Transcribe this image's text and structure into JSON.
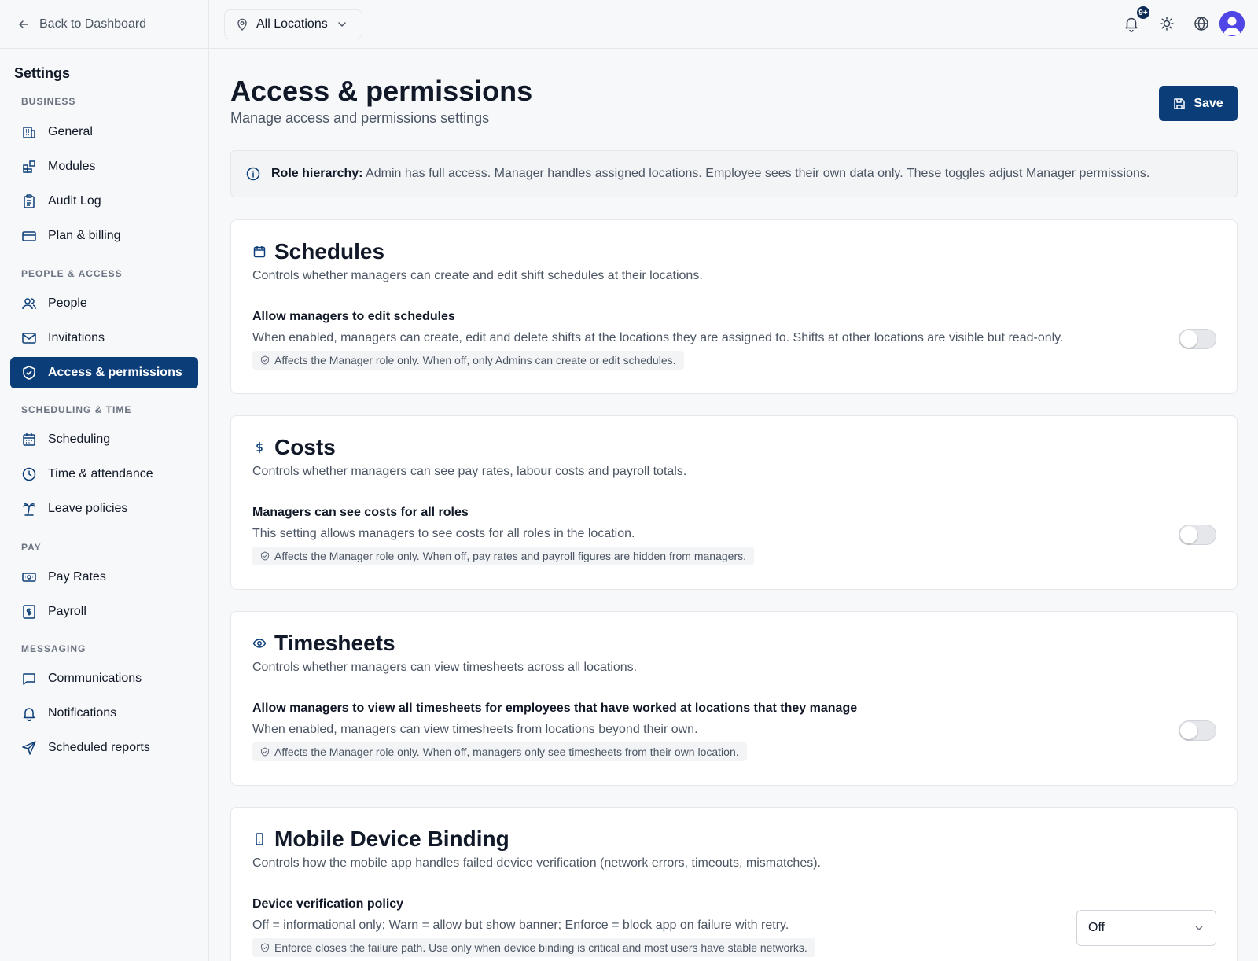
{
  "sidebar": {
    "back_label": "Back to Dashboard",
    "title": "Settings",
    "sections": {
      "business": "BUSINESS",
      "people": "PEOPLE & ACCESS",
      "scheduling": "SCHEDULING & TIME",
      "pay": "PAY",
      "messaging": "MESSAGING"
    },
    "items": {
      "general": "General",
      "modules": "Modules",
      "audit_log": "Audit Log",
      "plan_billing": "Plan & billing",
      "people": "People",
      "invitations": "Invitations",
      "access": "Access & permissions",
      "scheduling": "Scheduling",
      "time_attendance": "Time & attendance",
      "leave": "Leave policies",
      "pay_rates": "Pay Rates",
      "payroll": "Payroll",
      "communications": "Communications",
      "notifications": "Notifications",
      "scheduled_reports": "Scheduled reports"
    },
    "active_item": "access"
  },
  "topbar": {
    "location": "All Locations",
    "notification_badge": "9+"
  },
  "main": {
    "title": "Access & permissions",
    "subtitle": "Manage access and permissions settings",
    "save_label": "Save",
    "info": {
      "bold": "Role hierarchy:",
      "text": "Admin has full access. Manager handles assigned locations. Employee sees their own data only. These toggles adjust Manager permissions."
    },
    "cards": {
      "schedules": {
        "title": "Schedules",
        "desc": "Controls whether managers can create and edit shift schedules at their locations.",
        "row_title": "Allow managers to edit schedules",
        "row_desc": "When enabled, managers can create, edit and delete shifts at the locations they are assigned to. Shifts at other locations are visible but read-only.",
        "chip": "Affects the Manager role only. When off, only Admins can create or edit schedules.",
        "enabled": false
      },
      "costs": {
        "title": "Costs",
        "desc": "Controls whether managers can see pay rates, labour costs and payroll totals.",
        "row_title": "Managers can see costs for all roles",
        "row_desc": "This setting allows managers to see costs for all roles in the location.",
        "chip": "Affects the Manager role only. When off, pay rates and payroll figures are hidden from managers.",
        "enabled": false
      },
      "timesheets": {
        "title": "Timesheets",
        "desc": "Controls whether managers can view timesheets across all locations.",
        "row_title": "Allow managers to view all timesheets for employees that have worked at locations that they manage",
        "row_desc": "When enabled, managers can view timesheets from locations beyond their own.",
        "chip": "Affects the Manager role only. When off, managers only see timesheets from their own location.",
        "enabled": false
      },
      "mobile": {
        "title": "Mobile Device Binding",
        "desc": "Controls how the mobile app handles failed device verification (network errors, timeouts, mismatches).",
        "row_title": "Device verification policy",
        "row_desc": "Off = informational only; Warn = allow but show banner; Enforce = block app on failure with retry.",
        "chip": "Enforce closes the failure path. Use only when device binding is critical and most users have stable networks.",
        "policy_value": "Off"
      }
    }
  },
  "colors": {
    "accent": "#0b3d78",
    "background": "#f7f8fa"
  }
}
